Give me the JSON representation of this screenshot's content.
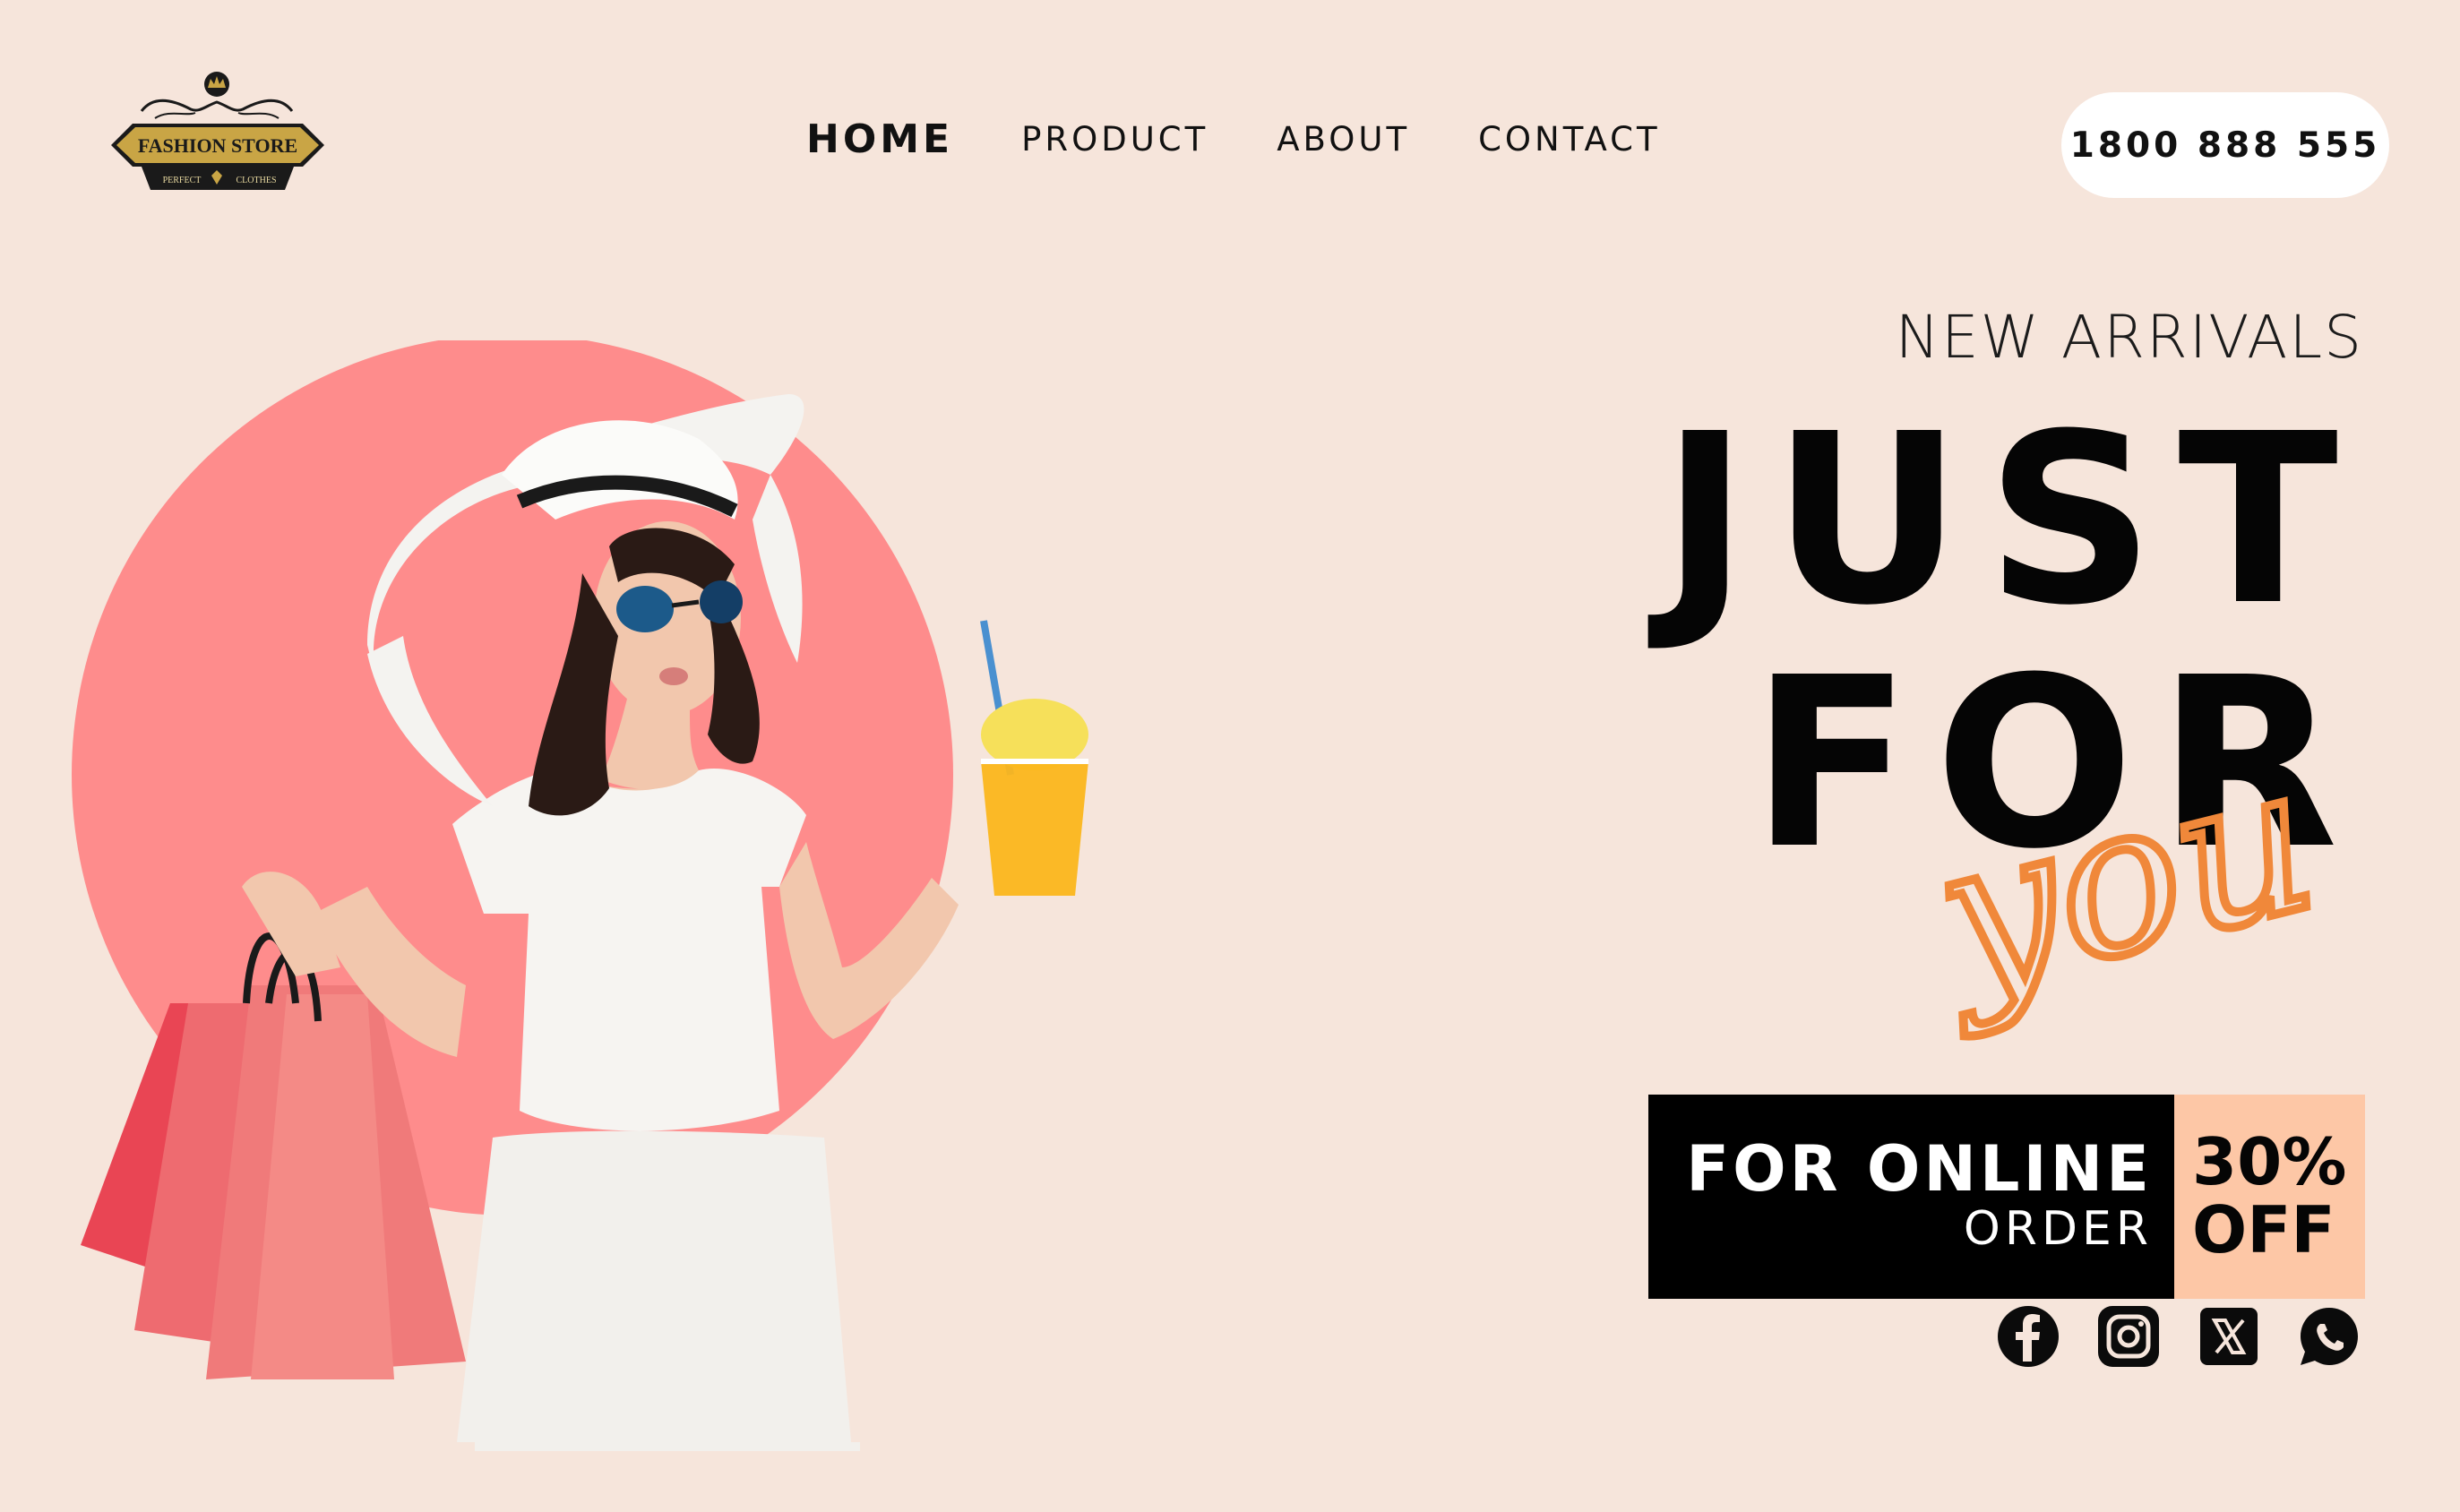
{
  "brand": {
    "logo_title": "FASHION STORE",
    "logo_tagline_left": "PERFECT",
    "logo_tagline_right": "CLOTHES"
  },
  "nav": {
    "items": [
      {
        "label": "HOME",
        "active": true
      },
      {
        "label": "PRODUCT",
        "active": false
      },
      {
        "label": "ABOUT",
        "active": false
      },
      {
        "label": "CONTACT",
        "active": false
      }
    ]
  },
  "phone": "1800 888 555",
  "hero": {
    "eyebrow": "NEW ARRIVALS",
    "headline_line1": "JUST",
    "headline_line2": "FOR",
    "script_word": "you"
  },
  "promo": {
    "line1": "FOR ONLINE",
    "line2": "ORDER",
    "discount_line1": "30%",
    "discount_line2": "OFF"
  },
  "socials": [
    {
      "icon": "facebook-icon"
    },
    {
      "icon": "instagram-icon"
    },
    {
      "icon": "x-icon"
    },
    {
      "icon": "whatsapp-icon"
    }
  ],
  "colors": {
    "background": "#f6e5db",
    "circle": "#fe8c8c",
    "accent_script": "#f0883a",
    "promo_dark": "#000000",
    "promo_light": "#fdc7a6",
    "logo_gold": "#c9a545"
  }
}
